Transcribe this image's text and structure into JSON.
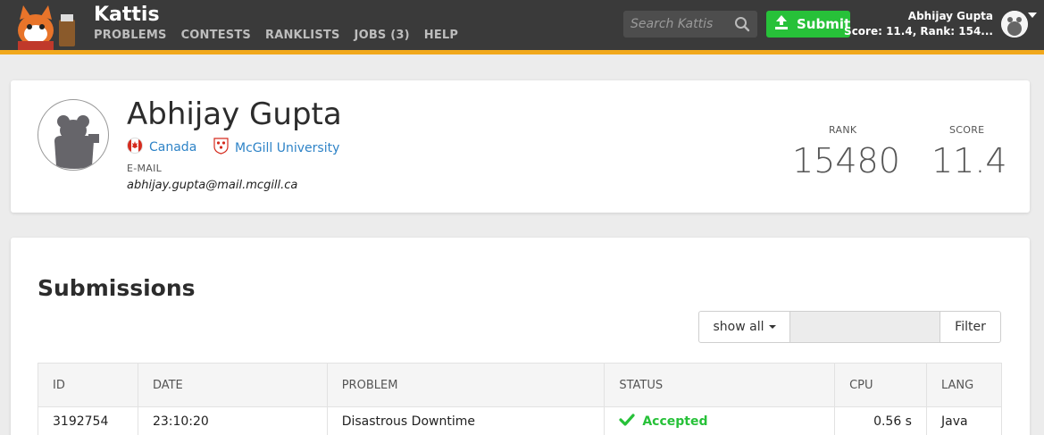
{
  "header": {
    "brand": "Kattis",
    "nav": [
      "PROBLEMS",
      "CONTESTS",
      "RANKLISTS",
      "JOBS (3)",
      "HELP"
    ],
    "search_placeholder": "Search Kattis",
    "submit_label": "Submit",
    "user_name": "Abhijay Gupta",
    "user_score": "Score: 11.4, Rank: 154..."
  },
  "profile": {
    "name": "Abhijay Gupta",
    "country": "Canada",
    "university": "McGill University",
    "email_label": "E-MAIL",
    "email": "abhijay.gupta@mail.mcgill.ca",
    "rank_label": "RANK",
    "rank": "15480",
    "score_label": "SCORE",
    "score": "11.4"
  },
  "submissions": {
    "title": "Submissions",
    "show_all": "show all",
    "filter_label": "Filter",
    "columns": [
      "ID",
      "DATE",
      "PROBLEM",
      "STATUS",
      "CPU",
      "LANG"
    ],
    "rows": [
      {
        "id": "3192754",
        "date": "23:10:20",
        "problem": "Disastrous Downtime",
        "status": "Accepted",
        "cpu": "0.56 s",
        "lang": "Java"
      }
    ]
  },
  "colors": {
    "accent": "#f1a81c",
    "submit": "#27c139",
    "link": "#2e83c7",
    "topbar": "#3a3a3a"
  }
}
